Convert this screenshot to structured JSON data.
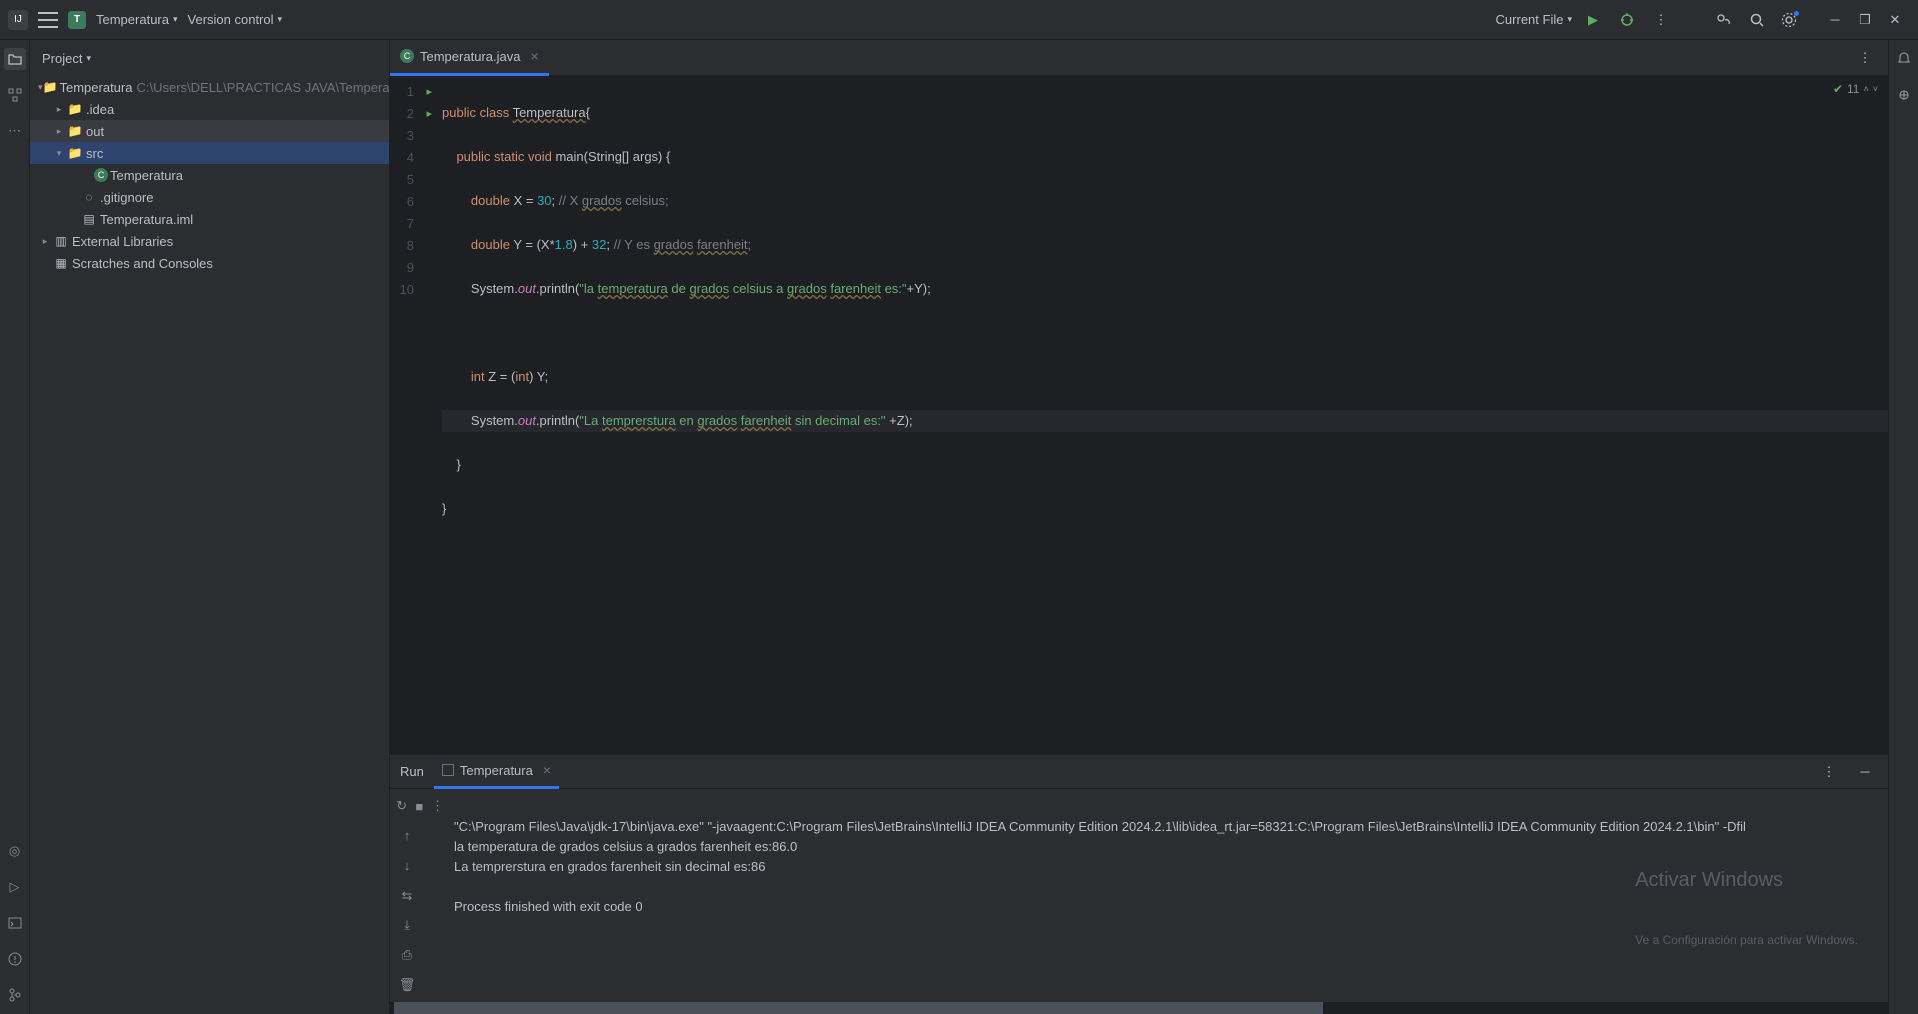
{
  "titlebar": {
    "project_name": "Temperatura",
    "vcs_label": "Version control",
    "run_target": "Current File"
  },
  "project_panel": {
    "title": "Project",
    "root_name": "Temperatura",
    "root_path": "C:\\Users\\DELL\\PRACTICAS JAVA\\Temperatura",
    "items": {
      "idea": ".idea",
      "out": "out",
      "src": "src",
      "class": "Temperatura",
      "gitignore": ".gitignore",
      "iml": "Temperatura.iml"
    },
    "external_libs": "External Libraries",
    "scratches": "Scratches and Consoles"
  },
  "editor": {
    "tab_name": "Temperatura.java",
    "status_count": "11",
    "lines": [
      "public class Temperatura{",
      "    public static void main(String[] args) {",
      "        double X = 30; // X grados celsius;",
      "        double Y = (X*1.8) + 32; // Y es grados farenheit;",
      "        System.out.println(\"la temperatura de grados celsius a grados farenheit es:\"+Y);",
      "",
      "        int Z = (int) Y;",
      "        System.out.println(\"La temprerstura en grados farenheit sin decimal es:\" +Z);",
      "    }",
      "}"
    ]
  },
  "run_panel": {
    "title": "Run",
    "config_name": "Temperatura",
    "output": "\"C:\\Program Files\\Java\\jdk-17\\bin\\java.exe\" \"-javaagent:C:\\Program Files\\JetBrains\\IntelliJ IDEA Community Edition 2024.2.1\\lib\\idea_rt.jar=58321:C:\\Program Files\\JetBrains\\IntelliJ IDEA Community Edition 2024.2.1\\bin\" -Dfil\nla temperatura de grados celsius a grados farenheit es:86.0\nLa temprerstura en grados farenheit sin decimal es:86\n\nProcess finished with exit code 0"
  },
  "watermark": {
    "line1": "Activar Windows",
    "line2": "Ve a Configuración para activar Windows."
  }
}
